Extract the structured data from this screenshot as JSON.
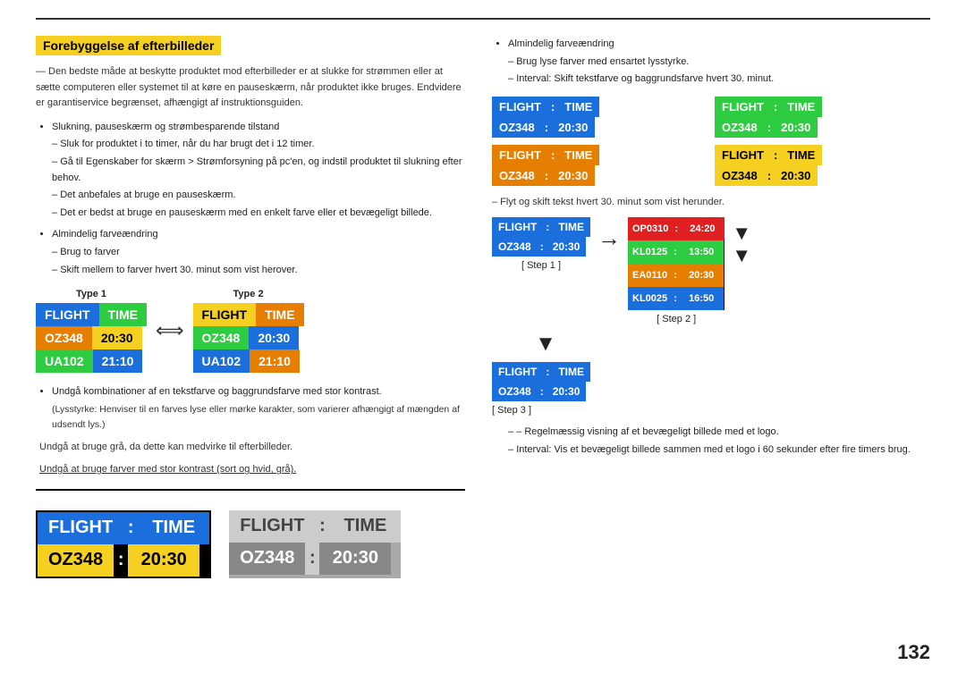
{
  "page": {
    "number": "132",
    "top_line": true
  },
  "section_title": "Forebyggelse af efterbilleder",
  "left_col": {
    "intro": "— Den bedste måde at beskytte produktet mod efterbilleder er at slukke for strømmen eller at sætte computeren eller systemet til at køre en pauseskærm, når produktet ikke bruges. Endvidere er garantiservice begrænset, afhængigt af instruktionsguiden.",
    "bullet1": "Slukning, pauseskærm og strømbesparende tilstand",
    "dash1a": "Sluk for produktet i to timer, når du har brugt det i 12 timer.",
    "dash1b": "Gå til Egenskaber for skærm > Strømforsyning på pc'en, og indstil produktet til slukning efter behov.",
    "dash1c": "Det anbefales at bruge en pauseskærm.",
    "dash1d": "Det er bedst at bruge en pauseskærm med en enkelt farve eller et bevægeligt billede.",
    "bullet2": "Almindelig farveændring",
    "dash2a": "Brug to farver",
    "dash2b": "Skift mellem to farver hvert 30. minut som vist herover.",
    "type1_label": "Type 1",
    "type2_label": "Type 2",
    "boards": {
      "type1": {
        "row1": [
          {
            "text": "FLIGHT",
            "bg": "blue"
          },
          {
            "text": "TIME",
            "bg": "green"
          }
        ],
        "row2": [
          {
            "text": "OZ348",
            "bg": "orange"
          },
          {
            "text": "20:30",
            "bg": "yellow"
          }
        ],
        "row3": [
          {
            "text": "UA102",
            "bg": "green"
          },
          {
            "text": "21:10",
            "bg": "blue"
          }
        ]
      },
      "type2": {
        "row1": [
          {
            "text": "FLIGHT",
            "bg": "yellow"
          },
          {
            "text": "TIME",
            "bg": "orange"
          }
        ],
        "row2": [
          {
            "text": "OZ348",
            "bg": "green"
          },
          {
            "text": "20:30",
            "bg": "blue"
          }
        ],
        "row3": [
          {
            "text": "UA102",
            "bg": "blue"
          },
          {
            "text": "21:10",
            "bg": "orange"
          }
        ]
      }
    },
    "bullet3": "Undgå kombinationer af en tekstfarve og baggrundsfarve med stor kontrast.",
    "bullet3_sub": "(Lysstyrke: Henviser til en farves lyse eller mørke karakter, som varierer afhængigt af mængden af udsendt lys.)",
    "dash3a": "Undgå at bruge grå, da dette kan medvirke til efterbilleder.",
    "dash3b": "Undgå at bruge farver med stor kontrast (sort og hvid, grå).",
    "bottom_board1": {
      "row1": [
        {
          "text": "FLIGHT",
          "bg": "blue"
        },
        {
          "colon": true,
          "text": ":",
          "bg": "blue"
        },
        {
          "text": "TIME",
          "bg": "blue"
        }
      ],
      "row2": [
        {
          "text": "OZ348",
          "bg": "yellow"
        },
        {
          "colon": true,
          "text": ":",
          "bg": "black"
        },
        {
          "text": "20:30",
          "bg": "yellow"
        }
      ]
    },
    "bottom_board2": {
      "row1": [
        {
          "text": "FLIGHT",
          "bg": "lgray"
        },
        {
          "colon": true,
          "text": ":",
          "bg": "lgray"
        },
        {
          "text": "TIME",
          "bg": "lgray"
        }
      ],
      "row2": [
        {
          "text": "OZ348",
          "bg": "lgray"
        },
        {
          "colon": true,
          "text": ":",
          "bg": "lgray"
        },
        {
          "text": "20:30",
          "bg": "lgray"
        }
      ]
    }
  },
  "right_col": {
    "bullet1": "Almindelig farveændring",
    "dash1a": "Brug lyse farver med ensartet lysstyrke.",
    "dash1b": "Interval: Skift tekstfarve og baggrundsfarve hvert 30. minut.",
    "grid_boards": [
      {
        "rows": [
          [
            {
              "text": "FLIGHT",
              "bg": "blue"
            },
            {
              "colon": true,
              "text": " : ",
              "bg": "blue"
            },
            {
              "text": "TIME",
              "bg": "blue"
            }
          ],
          [
            {
              "text": "OZ348",
              "bg": "blue"
            },
            {
              "colon": true,
              "text": " : ",
              "bg": "blue"
            },
            {
              "text": "20:30",
              "bg": "blue"
            }
          ]
        ]
      },
      {
        "rows": [
          [
            {
              "text": "FLIGHT",
              "bg": "green"
            },
            {
              "colon": true,
              "text": " : ",
              "bg": "green"
            },
            {
              "text": "TIME",
              "bg": "green"
            }
          ],
          [
            {
              "text": "OZ348",
              "bg": "green"
            },
            {
              "colon": true,
              "text": " : ",
              "bg": "green"
            },
            {
              "text": "20:30",
              "bg": "green"
            }
          ]
        ]
      },
      {
        "rows": [
          [
            {
              "text": "FLIGHT",
              "bg": "orange"
            },
            {
              "colon": true,
              "text": " : ",
              "bg": "orange"
            },
            {
              "text": "TIME",
              "bg": "orange"
            }
          ],
          [
            {
              "text": "OZ348",
              "bg": "orange"
            },
            {
              "colon": true,
              "text": " : ",
              "bg": "orange"
            },
            {
              "text": "20:30",
              "bg": "orange"
            }
          ]
        ]
      },
      {
        "rows": [
          [
            {
              "text": "FLIGHT",
              "bg": "yellow"
            },
            {
              "colon": true,
              "text": " : ",
              "bg": "yellow"
            },
            {
              "text": "TIME",
              "bg": "yellow"
            }
          ],
          [
            {
              "text": "OZ348",
              "bg": "yellow"
            },
            {
              "colon": true,
              "text": " : ",
              "bg": "yellow"
            },
            {
              "text": "20:30",
              "bg": "yellow"
            }
          ]
        ]
      }
    ],
    "dash2": "– Flyt og skift tekst hvert 30. minut som vist herunder.",
    "step1_board": {
      "rows": [
        [
          {
            "text": "FLIGHT",
            "bg": "blue"
          },
          {
            "colon": true,
            "text": " : ",
            "bg": "blue"
          },
          {
            "text": "TIME",
            "bg": "blue"
          }
        ],
        [
          {
            "text": "OZ348",
            "bg": "blue"
          },
          {
            "colon": true,
            "text": " : ",
            "bg": "blue"
          },
          {
            "text": "20:30",
            "bg": "blue"
          }
        ]
      ]
    },
    "step2_board": {
      "rows": [
        [
          {
            "text": "OP0310",
            "bg": "red"
          },
          {
            "colon": true,
            "text": " : ",
            "bg": "red"
          },
          {
            "text": "24:20",
            "bg": "red"
          }
        ],
        [
          {
            "text": "KL0125",
            "bg": "green"
          },
          {
            "colon": true,
            "text": " : ",
            "bg": "green"
          },
          {
            "text": "13:50",
            "bg": "green"
          }
        ],
        [
          {
            "text": "EA0110",
            "bg": "orange"
          },
          {
            "colon": true,
            "text": " : ",
            "bg": "orange"
          },
          {
            "text": "20:30",
            "bg": "orange"
          }
        ],
        [
          {
            "text": "KL0025",
            "bg": "blue"
          },
          {
            "colon": true,
            "text": " : ",
            "bg": "blue"
          },
          {
            "text": "16:50",
            "bg": "blue"
          }
        ]
      ]
    },
    "step3_board": {
      "rows": [
        [
          {
            "text": "FLIGHT",
            "bg": "blue"
          },
          {
            "colon": true,
            "text": " : ",
            "bg": "blue"
          },
          {
            "text": "TIME",
            "bg": "blue"
          }
        ],
        [
          {
            "text": "OZ348",
            "bg": "blue"
          },
          {
            "colon": true,
            "text": " : ",
            "bg": "blue"
          },
          {
            "text": "20:30",
            "bg": "blue"
          }
        ]
      ]
    },
    "step1_label": "[ Step 1 ]",
    "step2_label": "[ Step 2 ]",
    "step3_label": "[ Step 3 ]",
    "dash3": "– Regelmæssig visning af et bevægeligt billede med et logo.",
    "dash3b": "Interval: Vis et bevægeligt billede sammen med et logo i 60 sekunder efter fire timers brug."
  }
}
